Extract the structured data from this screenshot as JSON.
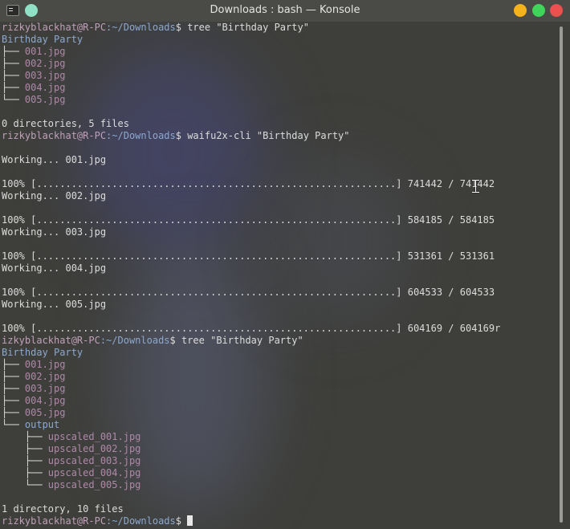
{
  "window": {
    "title": "Downloads : bash — Konsole",
    "controls": {
      "minimize_color": "#f6b21a",
      "maximize_color": "#3ed55a",
      "close_color": "#ee4f4f",
      "pin_color": "#8fe0c4"
    }
  },
  "colors": {
    "user": "#c0a0b8",
    "path": "#8ca8d0",
    "file": "#b088a8",
    "text": "#dcdcdc"
  },
  "terminal": {
    "lines": [
      {
        "type": "prompt",
        "user": "rizkyblackhat@R-PC",
        "path": ":~/Downloads",
        "sym": "$ ",
        "cmd": "tree \"Birthday Party\""
      },
      {
        "type": "dir",
        "prefix": "",
        "name": "Birthday Party"
      },
      {
        "type": "file",
        "prefix": "├── ",
        "name": "001.jpg"
      },
      {
        "type": "file",
        "prefix": "├── ",
        "name": "002.jpg"
      },
      {
        "type": "file",
        "prefix": "├── ",
        "name": "003.jpg"
      },
      {
        "type": "file",
        "prefix": "├── ",
        "name": "004.jpg"
      },
      {
        "type": "file",
        "prefix": "└── ",
        "name": "005.jpg"
      },
      {
        "type": "text",
        "text": ""
      },
      {
        "type": "text",
        "text": "0 directories, 5 files"
      },
      {
        "type": "prompt",
        "user": "rizkyblackhat@R-PC",
        "path": ":~/Downloads",
        "sym": "$ ",
        "cmd": "waifu2x-cli \"Birthday Party\""
      },
      {
        "type": "text",
        "text": ""
      },
      {
        "type": "text",
        "text": "Working... 001.jpg"
      },
      {
        "type": "text",
        "text": ""
      },
      {
        "type": "text",
        "text": "100% [..............................................................] 741442 / 741442"
      },
      {
        "type": "text",
        "text": "Working... 002.jpg"
      },
      {
        "type": "text",
        "text": ""
      },
      {
        "type": "text",
        "text": "100% [..............................................................] 584185 / 584185"
      },
      {
        "type": "text",
        "text": "Working... 003.jpg"
      },
      {
        "type": "text",
        "text": ""
      },
      {
        "type": "text",
        "text": "100% [..............................................................] 531361 / 531361"
      },
      {
        "type": "text",
        "text": "Working... 004.jpg"
      },
      {
        "type": "text",
        "text": ""
      },
      {
        "type": "text",
        "text": "100% [..............................................................] 604533 / 604533"
      },
      {
        "type": "text",
        "text": "Working... 005.jpg"
      },
      {
        "type": "text",
        "text": ""
      },
      {
        "type": "text",
        "text": "100% [..............................................................] 604169 / 604169r"
      },
      {
        "type": "prompt",
        "user": "izkyblackhat@R-PC",
        "path": ":~/Downloads",
        "sym": "$ ",
        "cmd": "tree \"Birthday Party\""
      },
      {
        "type": "dir",
        "prefix": "",
        "name": "Birthday Party"
      },
      {
        "type": "file",
        "prefix": "├── ",
        "name": "001.jpg"
      },
      {
        "type": "file",
        "prefix": "├── ",
        "name": "002.jpg"
      },
      {
        "type": "file",
        "prefix": "├── ",
        "name": "003.jpg"
      },
      {
        "type": "file",
        "prefix": "├── ",
        "name": "004.jpg"
      },
      {
        "type": "file",
        "prefix": "├── ",
        "name": "005.jpg"
      },
      {
        "type": "dir",
        "prefix": "└── ",
        "name": "output"
      },
      {
        "type": "file",
        "prefix": "    ├── ",
        "name": "upscaled_001.jpg"
      },
      {
        "type": "file",
        "prefix": "    ├── ",
        "name": "upscaled_002.jpg"
      },
      {
        "type": "file",
        "prefix": "    ├── ",
        "name": "upscaled_003.jpg"
      },
      {
        "type": "file",
        "prefix": "    ├── ",
        "name": "upscaled_004.jpg"
      },
      {
        "type": "file",
        "prefix": "    └── ",
        "name": "upscaled_005.jpg"
      },
      {
        "type": "text",
        "text": ""
      },
      {
        "type": "text",
        "text": "1 directory, 10 files"
      },
      {
        "type": "prompt",
        "user": "rizkyblackhat@R-PC",
        "path": ":~/Downloads",
        "sym": "$ ",
        "cmd": "",
        "cursor": true
      }
    ]
  }
}
